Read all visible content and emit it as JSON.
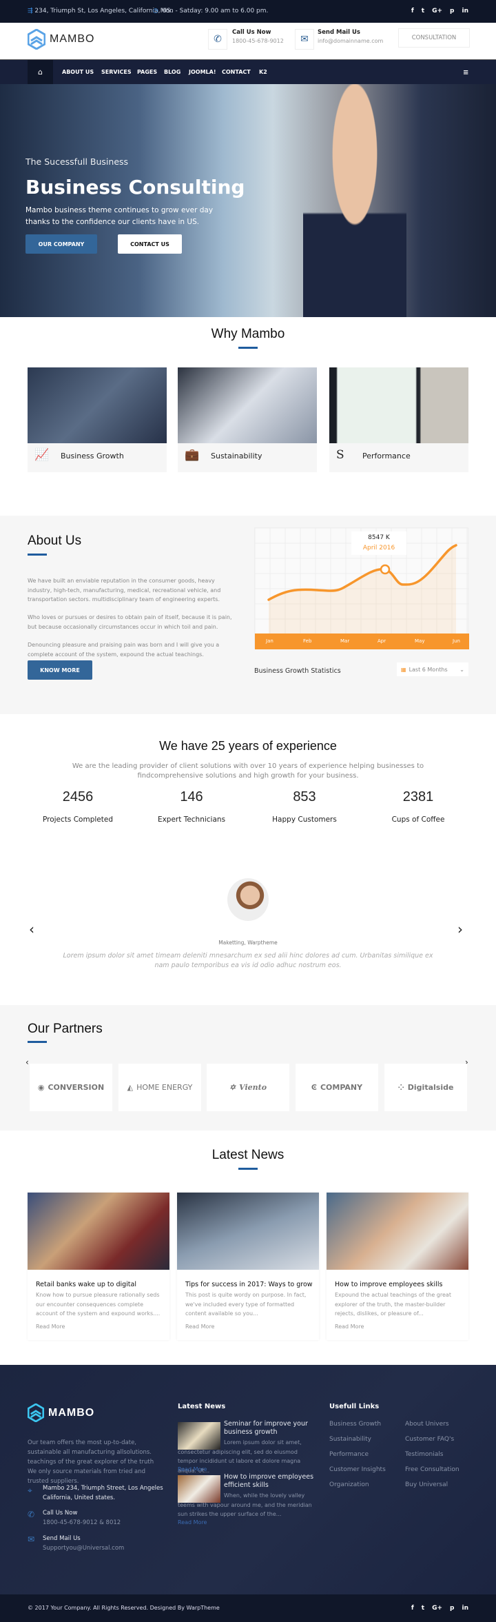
{
  "topbar": {
    "address": "234, Triumph St, Los Angeles, California, US.",
    "hours": "Mon - Satday: 9.00 am to 6.00 pm.",
    "social": [
      "f",
      "t",
      "G+",
      "p",
      "in"
    ]
  },
  "header": {
    "logo": "MAMBO",
    "call_title": "Call Us Now",
    "call_value": "1800-45-678-9012",
    "mail_title": "Send Mail Us",
    "mail_value": "info@domainname.com",
    "consult": "CONSULTATION"
  },
  "nav": {
    "items": [
      "ABOUT US",
      "SERVICES",
      "PAGES",
      "BLOG",
      "JOOMLA!",
      "CONTACT",
      "K2"
    ]
  },
  "hero": {
    "kicker": "The Sucessfull Business",
    "title": "Business Consulting",
    "text": "Mambo business theme continues to grow ever day thanks to the confidence our clients have in US.",
    "btn1": "OUR COMPANY",
    "btn2": "CONTACT US"
  },
  "why": {
    "title": "Why Mambo",
    "cards": [
      {
        "label": "Business Growth",
        "icon": "chart-icon"
      },
      {
        "label": "Sustainability",
        "icon": "briefcase-icon"
      },
      {
        "label": "Performance",
        "icon": "s-icon"
      }
    ]
  },
  "about": {
    "title": "About Us",
    "p1": "We have built an enviable reputation in the consumer goods, heavy industry, high-tech, manufacturing, medical, recreational vehicle, and transportation sectors. multidisciplinary team of engineering experts.",
    "p2": "Who loves or pursues or desires to obtain pain of itself, because it is pain, but because occasionally circumstances occur in which toil and pain.",
    "p3": "Denouncing pleasure and praising pain was born and I will give you a complete account of the system, expound the actual teachings.",
    "button": "KNOW MORE"
  },
  "growth": {
    "caption": "Business Growth Statistics",
    "filter": "Last 6 Months",
    "tooltip_value": "8547 K",
    "tooltip_date": "April 2016",
    "months": [
      "Jan",
      "Feb",
      "Mar",
      "Apr",
      "May",
      "Jun"
    ],
    "accent": "#f7962c"
  },
  "experience": {
    "title": "We have 25 years of experience",
    "subtitle": "We are the leading provider of client solutions with over 10 years of experience helping businesses to findcomprehensive solutions and high growth for your business.",
    "stats": [
      {
        "n": "2456",
        "l": "Projects Completed"
      },
      {
        "n": "146",
        "l": "Expert Technicians"
      },
      {
        "n": "853",
        "l": "Happy Customers"
      },
      {
        "n": "2381",
        "l": "Cups of Coffee"
      }
    ]
  },
  "testimonial": {
    "role": "Maketting, Warptheme",
    "quote": "Lorem ipsum dolor sit amet timeam deleniti mnesarchum ex sed alii hinc dolores ad cum. Urbanitas similique ex nam paulo temporibus ea vis id odio adhuc nostrum eos."
  },
  "partners": {
    "title": "Our Partners",
    "logos": [
      "CONVERSION",
      "HOME ENERGY",
      "Viento",
      "COMPANY",
      "Digitalside"
    ]
  },
  "news": {
    "title": "Latest News",
    "read_more": "Read More",
    "items": [
      {
        "t": "Retail banks wake up to digital",
        "d": "Know how to pursue pleasure rationally seds our encounter consequences complete account of the system and expound works...."
      },
      {
        "t": "Tips for success in 2017: Ways to grow",
        "d": "This post is quite wordy on purpose. In fact, we've included every type of formatted content available so you..."
      },
      {
        "t": "How to improve employees skills",
        "d": "Expound the actual teachings of the great explorer of the truth, the master-builder rejects, dislikes, or pleasure of..."
      }
    ]
  },
  "footer": {
    "logo": "MAMBO",
    "about": "Our team offers the most up-to-date, sustainable all manufacturing allsolutions. teachings of the great explorer of the truth We only source materials from tried and trusted suppliers.",
    "address": "Mambo 234, Triumph Street, Los Angeles California, United states.",
    "call_title": "Call Us Now",
    "call_value": "1800-45-678-9012 & 8012",
    "mail_title": "Send Mail Us",
    "mail_value": "Supportyou@Universal.com",
    "news_title": "Latest News",
    "news": [
      {
        "t": "Seminar for improve your business growth",
        "d": "Lorem ipsum dolor sit amet, consectetur adipiscing elit, sed do eiusmod tempor incididunt ut labore et dolore magna aliqua. Ut..."
      },
      {
        "t": "How to improve employees efficient skills",
        "d": "When, while the lovely valley teems with vapour around me, and the meridian sun strikes the upper surface of the..."
      }
    ],
    "read_more": "Read More",
    "links_title": "Usefull Links",
    "links_col1": [
      "Business Growth",
      "Sustainability",
      "Performance",
      "Customer Insights",
      "Organization"
    ],
    "links_col2": [
      "About Univers",
      "Customer FAQ's",
      "Testimonials",
      "Free Consultation",
      "Buy Universal"
    ],
    "copyright": "© 2017 Your Company. All Rights Reserved. Designed By WarpTheme"
  }
}
